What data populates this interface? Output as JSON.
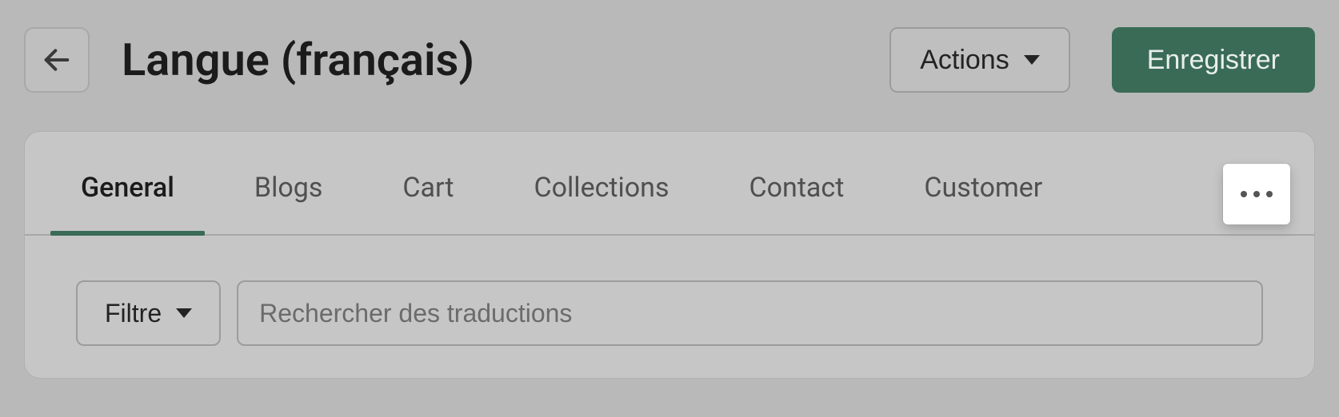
{
  "header": {
    "title": "Langue (français)",
    "actions_label": "Actions",
    "save_label": "Enregistrer"
  },
  "tabs": [
    {
      "label": "General",
      "active": true
    },
    {
      "label": "Blogs",
      "active": false
    },
    {
      "label": "Cart",
      "active": false
    },
    {
      "label": "Collections",
      "active": false
    },
    {
      "label": "Contact",
      "active": false
    },
    {
      "label": "Customer",
      "active": false
    }
  ],
  "filter": {
    "button_label": "Filtre",
    "search_placeholder": "Rechercher des traductions",
    "search_value": ""
  },
  "icons": {
    "back": "arrow-left-icon",
    "more": "more-horizontal-icon"
  },
  "colors": {
    "accent": "#3a6b56",
    "page_bg": "#b9b9b9",
    "card_bg": "#c6c6c6"
  }
}
